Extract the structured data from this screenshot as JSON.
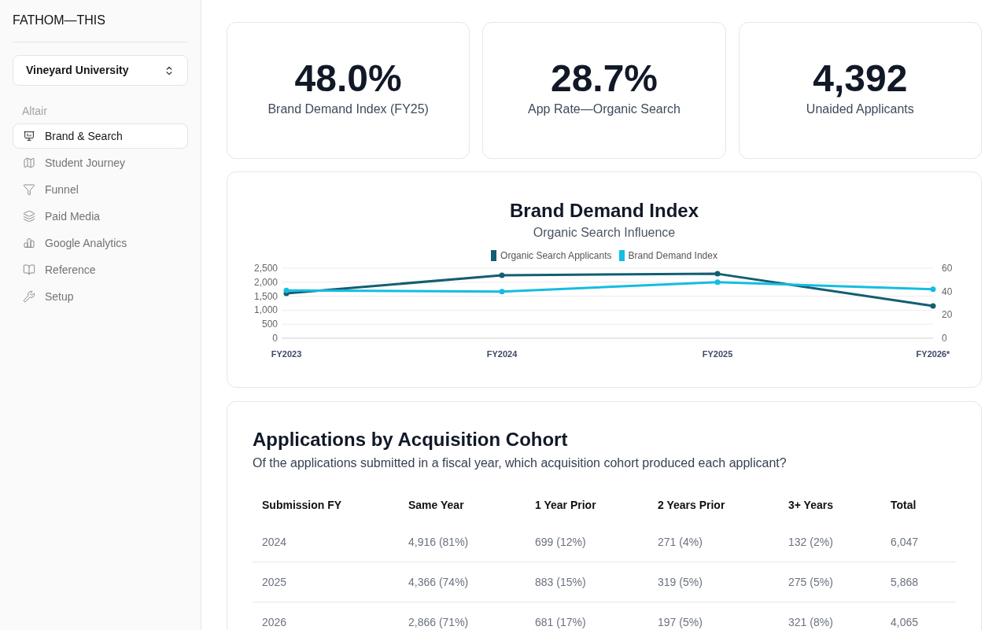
{
  "sidebar": {
    "brand": "FATHOM—THIS",
    "org_select": {
      "value": "Vineyard University"
    },
    "section_label": "Altair",
    "items": [
      {
        "label": "Brand & Search",
        "selected": true
      },
      {
        "label": "Student Journey",
        "selected": false
      },
      {
        "label": "Funnel",
        "selected": false
      },
      {
        "label": "Paid Media",
        "selected": false
      },
      {
        "label": "Google Analytics",
        "selected": false
      },
      {
        "label": "Reference",
        "selected": false
      },
      {
        "label": "Setup",
        "selected": false
      }
    ]
  },
  "kpis": [
    {
      "value": "48.0%",
      "label": "Brand Demand Index (FY25)"
    },
    {
      "value": "28.7%",
      "label": "App Rate—Organic Search"
    },
    {
      "value": "4,392",
      "label": "Unaided Applicants"
    }
  ],
  "chart_panel": {
    "title": "Brand Demand Index",
    "subtitle": "Organic Search Influence",
    "chart_data": {
      "type": "line",
      "categories": [
        "FY2023",
        "FY2024",
        "FY2025",
        "FY2026*"
      ],
      "series": [
        {
          "name": "Organic Search Applicants",
          "color": "#135e72",
          "axis": "y",
          "marker": "circle",
          "values": [
            1600,
            2250,
            2300,
            1150
          ]
        },
        {
          "name": "Brand Demand Index",
          "color": "#14bde0",
          "axis": "y2",
          "marker": "circle",
          "values": [
            41,
            40,
            48,
            42
          ]
        }
      ],
      "ylim": [
        0,
        2500
      ],
      "yticks": [
        {
          "value": 0,
          "label": "0"
        },
        {
          "value": 500,
          "label": "500"
        },
        {
          "value": 1000,
          "label": "1,000"
        },
        {
          "value": 1500,
          "label": "1,500"
        },
        {
          "value": 2000,
          "label": "2,000"
        },
        {
          "value": 2500,
          "label": "2,500"
        }
      ],
      "y2lim": [
        0,
        60
      ],
      "y2ticks": [
        0,
        20,
        40,
        60
      ],
      "grid": true,
      "legend": "top"
    }
  },
  "cohort_table": {
    "title": "Applications by Acquisition Cohort",
    "subtitle": "Of the applications submitted in a fiscal year, which acquisition cohort produced each applicant?",
    "columns": [
      "Submission FY",
      "Same Year",
      "1 Year Prior",
      "2 Years Prior",
      "3+ Years",
      "Total"
    ],
    "rows": [
      [
        "2024",
        "4,916 (81%)",
        "699 (12%)",
        "271 (4%)",
        "132 (2%)",
        "6,047"
      ],
      [
        "2025",
        "4,366 (74%)",
        "883 (15%)",
        "319 (5%)",
        "275 (5%)",
        "5,868"
      ],
      [
        "2026",
        "2,866 (71%)",
        "681 (17%)",
        "197 (5%)",
        "321 (8%)",
        "4,065"
      ]
    ]
  }
}
